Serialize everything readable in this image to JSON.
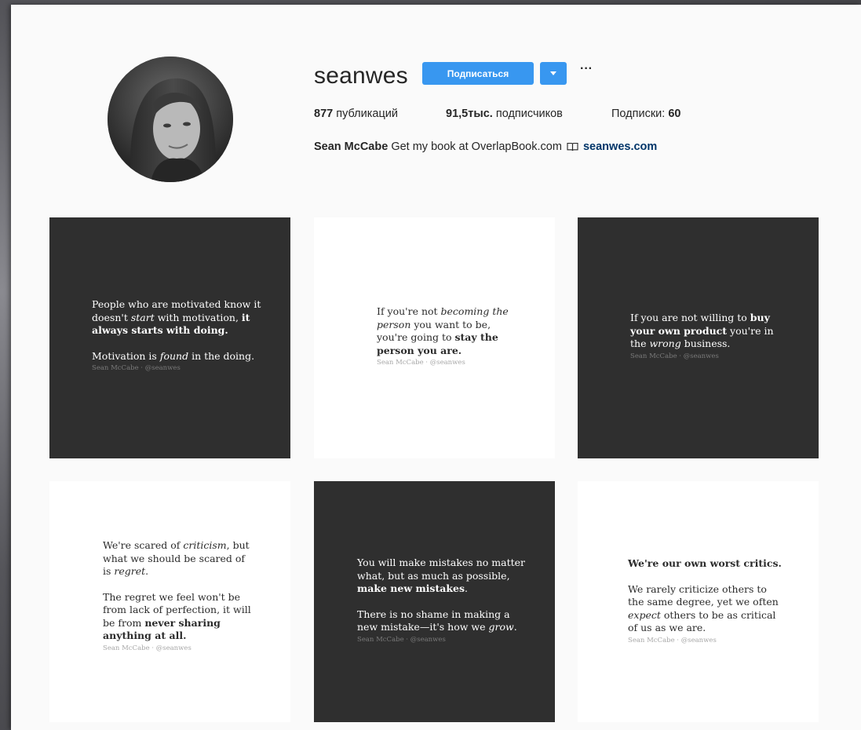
{
  "profile": {
    "username": "seanwes",
    "follow_label": "Подписаться",
    "dropdown_icon": "chevron-down-icon",
    "more_label": "···",
    "stats": {
      "posts_count": "877",
      "posts_label": "публикаций",
      "followers_count": "91,5тыс.",
      "followers_label": "подписчиков",
      "following_label": "Подписки:",
      "following_count": "60"
    },
    "bio": {
      "name": "Sean McCabe",
      "text": "Get my book at OverlapBook.com",
      "icon": "open-book-icon",
      "link": "seanwes.com"
    }
  },
  "posts": [
    {
      "theme": "dark",
      "paragraphs": [
        [
          {
            "t": "People who are motivated know it doesn't "
          },
          {
            "t": "start",
            "s": "i"
          },
          {
            "t": " with motivation, "
          },
          {
            "t": "it always starts with doing.",
            "s": "b"
          }
        ],
        [
          {
            "t": "Motivation is "
          },
          {
            "t": "found",
            "s": "i"
          },
          {
            "t": " in the doing."
          }
        ]
      ],
      "signature": "Sean McCabe · @seanwes"
    },
    {
      "theme": "light",
      "paragraphs": [
        [
          {
            "t": "If you're not "
          },
          {
            "t": "becoming the person",
            "s": "i"
          },
          {
            "t": " you want to be, you're going to "
          },
          {
            "t": "stay the person you are.",
            "s": "b"
          }
        ]
      ],
      "signature": "Sean McCabe · @seanwes"
    },
    {
      "theme": "dark",
      "paragraphs": [
        [
          {
            "t": "If you are not willing to "
          },
          {
            "t": "buy your own product",
            "s": "b"
          },
          {
            "t": " you're in the "
          },
          {
            "t": "wrong",
            "s": "i"
          },
          {
            "t": " business."
          }
        ]
      ],
      "signature": "Sean McCabe · @seanwes"
    },
    {
      "theme": "light",
      "paragraphs": [
        [
          {
            "t": "We're scared of "
          },
          {
            "t": "criticism",
            "s": "i"
          },
          {
            "t": ", but what we should be scared of is "
          },
          {
            "t": "regret",
            "s": "i"
          },
          {
            "t": "."
          }
        ],
        [
          {
            "t": "The regret we feel won't be from lack of perfection, it will be from "
          },
          {
            "t": "never sharing anything at all.",
            "s": "b"
          }
        ]
      ],
      "signature": "Sean McCabe · @seanwes"
    },
    {
      "theme": "dark",
      "paragraphs": [
        [
          {
            "t": "You will make mistakes no matter what, but as much as possible, "
          },
          {
            "t": "make new mistakes",
            "s": "b"
          },
          {
            "t": "."
          }
        ],
        [
          {
            "t": "There is no shame in making a new mistake—it's how we "
          },
          {
            "t": "grow",
            "s": "i"
          },
          {
            "t": "."
          }
        ]
      ],
      "signature": "Sean McCabe · @seanwes"
    },
    {
      "theme": "light",
      "paragraphs": [
        [
          {
            "t": "We're our own worst critics.",
            "s": "b"
          }
        ],
        [
          {
            "t": "We rarely criticize others to the same degree, yet we often "
          },
          {
            "t": "expect",
            "s": "i"
          },
          {
            "t": " others to be as critical of us as we are."
          }
        ]
      ],
      "signature": "Sean McCabe · @seanwes"
    }
  ],
  "colors": {
    "follow_button": "#3897f0",
    "link": "#003569",
    "dark_post": "#2f2f2f",
    "light_post": "#ffffff"
  }
}
